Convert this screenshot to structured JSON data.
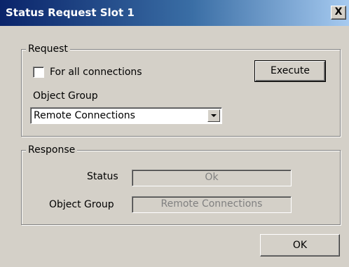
{
  "window": {
    "title": "Status Request Slot 1",
    "close_glyph": "X"
  },
  "request": {
    "legend": "Request",
    "for_all_connections": {
      "label": "For all connections",
      "checked": false
    },
    "execute_label": "Execute",
    "object_group_label": "Object Group",
    "object_group_value": "Remote Connections"
  },
  "response": {
    "legend": "Response",
    "status_label": "Status",
    "status_value": "Ok",
    "object_group_label": "Object Group",
    "object_group_value": "Remote Connections"
  },
  "footer": {
    "ok_label": "OK"
  },
  "colors": {
    "titlebar_start": "#0a246a",
    "titlebar_end": "#a6caf0",
    "dialog_bg": "#d4d0c8",
    "disabled_text": "#808080"
  }
}
